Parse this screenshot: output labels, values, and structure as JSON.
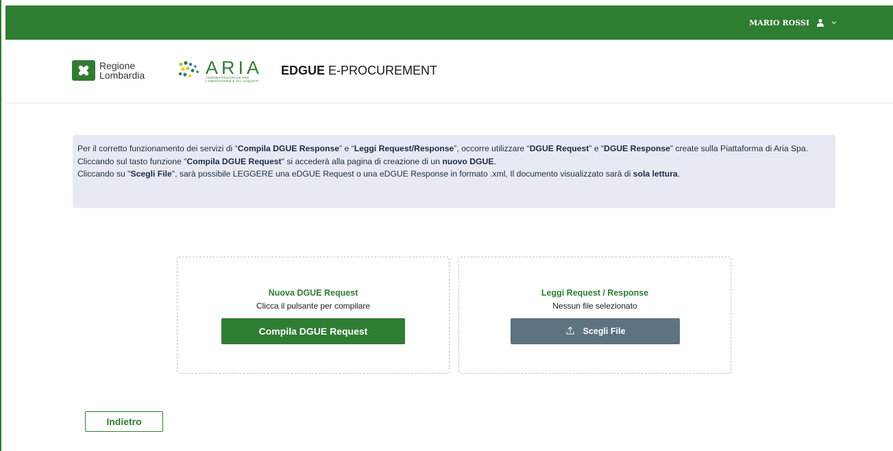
{
  "header": {
    "user_name": "MARIO ROSSI",
    "logo_regione_line1": "Regione",
    "logo_regione_line2": "Lombardia",
    "logo_aria_word": "ARIA",
    "logo_aria_sub1": "AZIENDA REGIONALE PER",
    "logo_aria_sub2": "L'INNOVAZIONE E GLI ACQUISTI",
    "app_title_bold": "EDGUE",
    "app_title_rest": " E-PROCUREMENT"
  },
  "info": {
    "l1_a": "Per il corretto funzionamento dei servizi di “",
    "l1_b": "Compila DGUE Response",
    "l1_c": "” e “",
    "l1_d": "Leggi Request/Response",
    "l1_e": "”, occorre utilizzare “",
    "l1_f": "DGUE Request",
    "l1_g": "” e “",
    "l1_h": "DGUE Response",
    "l1_i": "” create sulla Piattaforma di Aria Spa.",
    "l2_a": "Cliccando sul tasto funzione \"",
    "l2_b": "Compila DGUE Request",
    "l2_c": "\" si accederà alla pagina di creazione di un ",
    "l2_d": "nuovo DGUE",
    "l2_e": ".",
    "l3_a": "Cliccando su \"",
    "l3_b": "Scegli File",
    "l3_c": "\", sarà possibile LEGGERE una eDGUE Request o una eDGUE Response in formato .xml, Il documento visualizzato sarà di ",
    "l3_d": "sola lettura",
    "l3_e": "."
  },
  "cards": {
    "new_title": "Nuova DGUE Request",
    "new_sub": "Clicca il pulsante per compilare",
    "new_button": "Compila DGUE Request",
    "read_title": "Leggi Request / Response",
    "read_sub": "Nessun file selezionato",
    "read_button": "Scegli File"
  },
  "footer": {
    "back_button": "Indietro"
  },
  "colors": {
    "primary_green": "#2e7d32",
    "slate_button": "#5d7380",
    "info_bg": "#e7eaf2"
  },
  "icons": {
    "user": "user-icon",
    "chevron": "chevron-down-icon",
    "upload": "upload-icon"
  }
}
